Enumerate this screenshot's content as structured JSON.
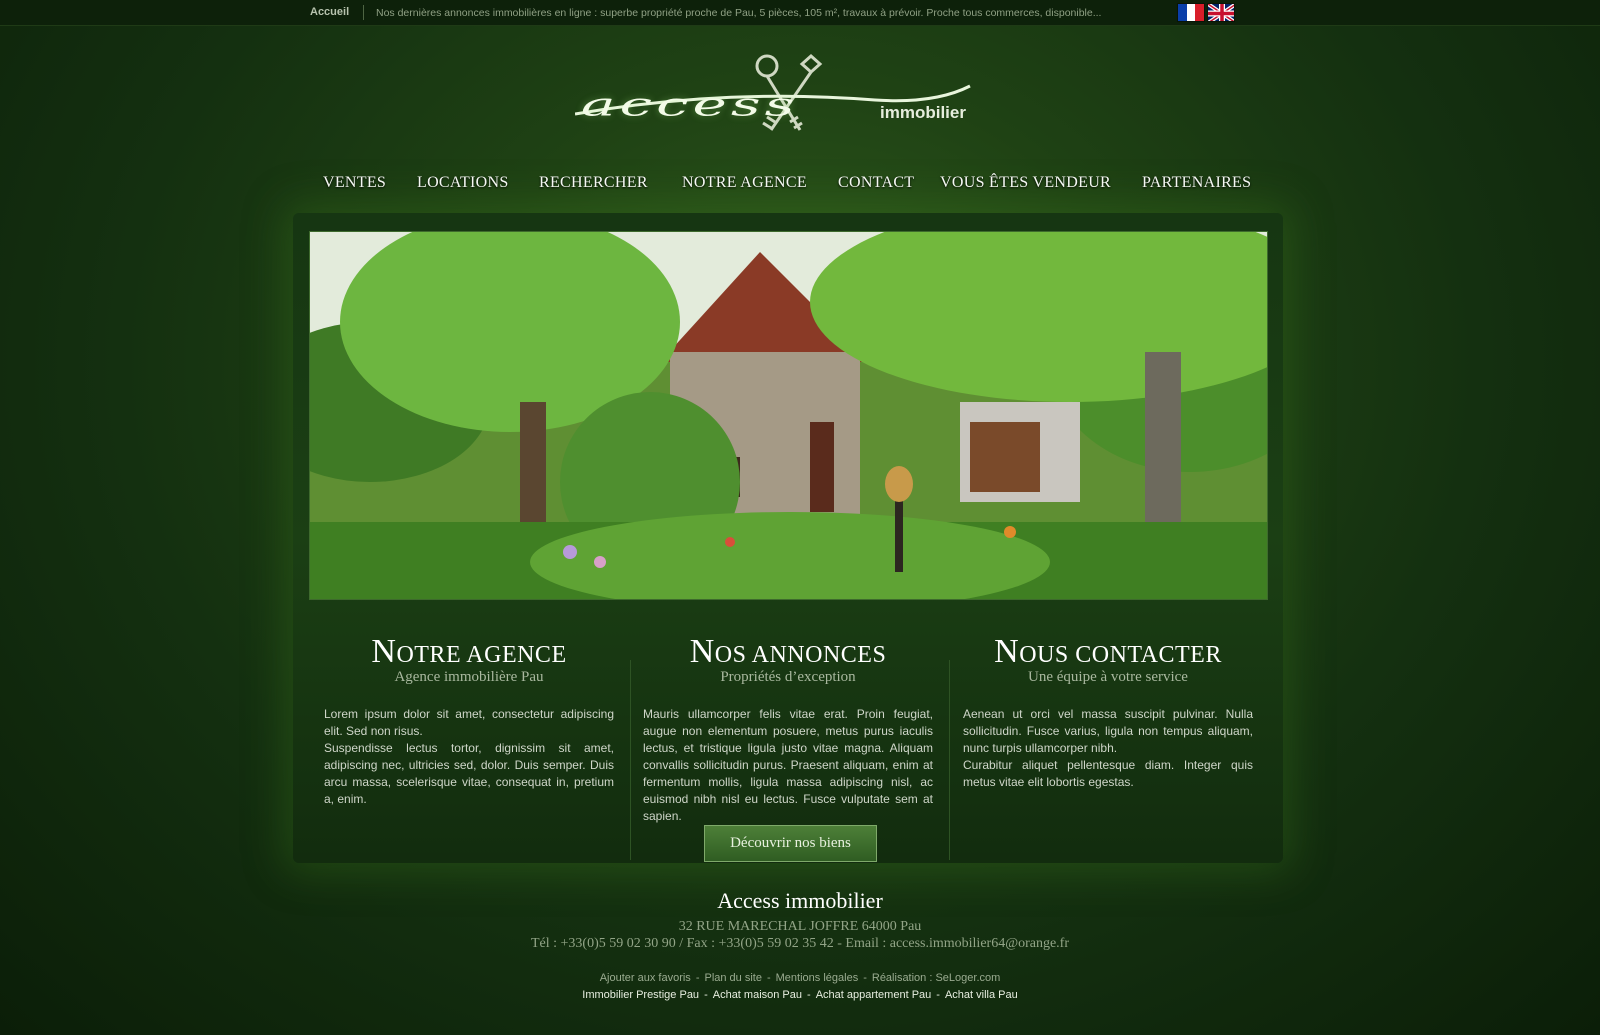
{
  "topbar": {
    "home": "Accueil",
    "ticker": "Nos dernières annonces immobilières en ligne : superbe propriété proche de Pau, 5 pièces, 105 m², travaux à prévoir. Proche tous commerces, disponible..."
  },
  "logo": {
    "word": "access",
    "sub": "immobilier"
  },
  "nav": [
    "VENTES",
    "LOCATIONS",
    "RECHERCHER",
    "NOTRE AGENCE",
    "CONTACT",
    "VOUS ÊTES VENDEUR",
    "PARTENAIRES"
  ],
  "columns": [
    {
      "cap": "N",
      "title": "OTRE AGENCE",
      "sub": "Agence immobilière Pau",
      "p1": "Lorem ipsum dolor sit amet, consectetur adipiscing elit. Sed non risus.",
      "p2": "Suspendisse lectus tortor, dignissim sit amet, adipiscing nec, ultricies sed, dolor. Duis semper. Duis arcu massa, scelerisque vitae, consequat in, pretium a, enim."
    },
    {
      "cap": "N",
      "title": "OS ANNONCES",
      "sub": "Propriétés d’exception",
      "p1": "Mauris ullamcorper felis vitae erat. Proin feugiat, augue non elementum posuere, metus purus iaculis lectus, et tristique ligula justo vitae magna. Aliquam convallis sollicitudin purus. Praesent aliquam, enim at fermentum mollis, ligula massa adipiscing nisl, ac euismod nibh nisl eu lectus. Fusce vulputate sem at sapien.",
      "button": "Découvrir nos biens"
    },
    {
      "cap": "N",
      "title": "OUS CONTACTER",
      "sub": "Une équipe à votre service",
      "p1": "Aenean ut orci vel massa suscipit pulvinar. Nulla sollicitudin. Fusce varius, ligula non tempus aliquam, nunc turpis ullamcorper nibh.",
      "p2": "Curabitur aliquet pellentesque diam. Integer quis metus vitae elit lobortis egestas."
    }
  ],
  "footer": {
    "title": "Access immobilier",
    "address": "32 RUE MARECHAL JOFFRE 64000 Pau",
    "contact": "Tél : +33(0)5 59 02 30 90 / Fax : +33(0)5 59 02 35 42 - Email : access.immobilier64@orange.fr",
    "links1": [
      "Ajouter aux favoris",
      "Plan du site",
      "Mentions légales",
      "Réalisation : SeLoger.com"
    ],
    "links2": [
      "Immobilier Prestige Pau",
      "Achat maison Pau",
      "Achat appartement Pau",
      "Achat villa Pau"
    ]
  },
  "colors": {
    "background": "#1f4214",
    "accent": "#4d7f38"
  }
}
